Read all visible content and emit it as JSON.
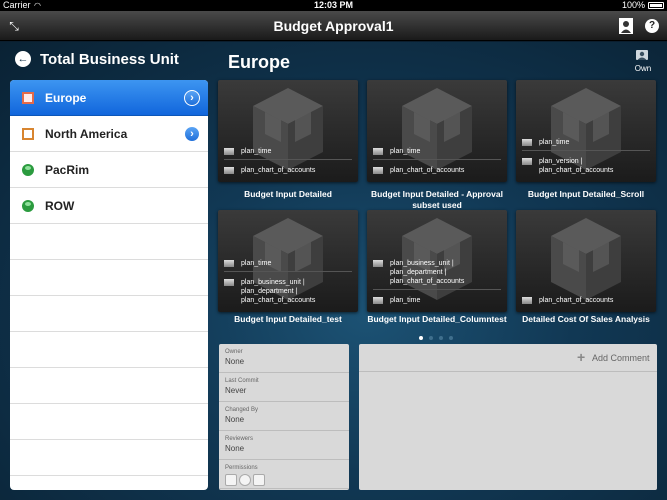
{
  "status_bar": {
    "carrier": "Carrier",
    "time": "12:03 PM",
    "battery": "100%"
  },
  "nav": {
    "title": "Budget Approval1",
    "left_icon": "expand-icon",
    "right_icons": [
      "user-icon",
      "help-icon"
    ]
  },
  "sidebar": {
    "title": "Total Business Unit",
    "items": [
      {
        "label": "Europe",
        "icon": "business-unit-icon",
        "selected": true,
        "has_children": true
      },
      {
        "label": "North America",
        "icon": "business-unit-icon",
        "selected": false,
        "has_children": true
      },
      {
        "label": "PacRim",
        "icon": "person-icon",
        "selected": false,
        "has_children": false
      },
      {
        "label": "ROW",
        "icon": "person-icon",
        "selected": false,
        "has_children": false
      }
    ]
  },
  "main": {
    "region": "Europe",
    "own_label": "Own",
    "cards": [
      {
        "caption": "Budget Input Detailed",
        "top_dims": [
          "plan_time"
        ],
        "bottom_dims": [
          "plan_chart_of_accounts"
        ]
      },
      {
        "caption": "Budget Input Detailed - Approval subset used",
        "top_dims": [
          "plan_time"
        ],
        "bottom_dims": [
          "plan_chart_of_accounts"
        ]
      },
      {
        "caption": "Budget Input Detailed_Scroll",
        "top_dims": [
          "plan_time"
        ],
        "bottom_dims": [
          "plan_version |",
          "plan_chart_of_accounts"
        ]
      },
      {
        "caption": "Budget Input Detailed_test",
        "top_dims": [
          "plan_time"
        ],
        "bottom_dims": [
          "plan_business_unit |",
          "plan_department |",
          "plan_chart_of_accounts"
        ]
      },
      {
        "caption": "Budget Input Detailed_Columntest",
        "top_dims": [
          "plan_business_unit |",
          "plan_department |",
          "plan_chart_of_accounts"
        ],
        "bottom_dims": [
          "plan_time"
        ]
      },
      {
        "caption": "Detailed Cost Of Sales Analysis",
        "top_dims": [],
        "bottom_dims": [
          "plan_chart_of_accounts"
        ]
      }
    ],
    "pagination": {
      "pages": 4,
      "current": 1
    }
  },
  "properties": [
    {
      "key": "Owner",
      "value": "None"
    },
    {
      "key": "Last Commit",
      "value": "Never"
    },
    {
      "key": "Changed By",
      "value": "None"
    },
    {
      "key": "Reviewers",
      "value": "None"
    },
    {
      "key": "Permissions",
      "icons": [
        "view-icon",
        "lock-icon",
        "edit-icon"
      ]
    }
  ],
  "comments": {
    "add_label": "Add Comment"
  },
  "colors": {
    "selected_row": "#1a75e8",
    "background": "#113854",
    "card": "#262626"
  }
}
